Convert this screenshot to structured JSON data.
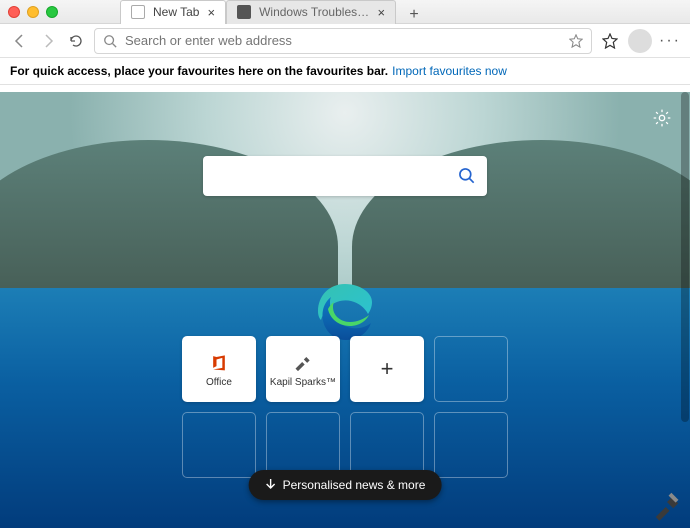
{
  "titlebar": {
    "tabs": [
      {
        "label": "New Tab",
        "active": true
      },
      {
        "label": "Windows Troubleshooting, Ho…",
        "active": false
      }
    ]
  },
  "toolbar": {
    "address_placeholder": "Search or enter web address"
  },
  "fav_bar": {
    "message": "For quick access, place your favourites here on the favourites bar.",
    "link": "Import favourites now"
  },
  "content": {
    "search_placeholder": "",
    "news_button": "Personalised news & more",
    "tiles": [
      {
        "label": "Office",
        "kind": "office"
      },
      {
        "label": "Kapil Sparks™",
        "kind": "site"
      },
      {
        "label": "",
        "kind": "add"
      },
      {
        "label": "",
        "kind": "empty"
      },
      {
        "label": "",
        "kind": "empty"
      },
      {
        "label": "",
        "kind": "empty"
      },
      {
        "label": "",
        "kind": "empty"
      },
      {
        "label": "",
        "kind": "empty"
      }
    ]
  }
}
